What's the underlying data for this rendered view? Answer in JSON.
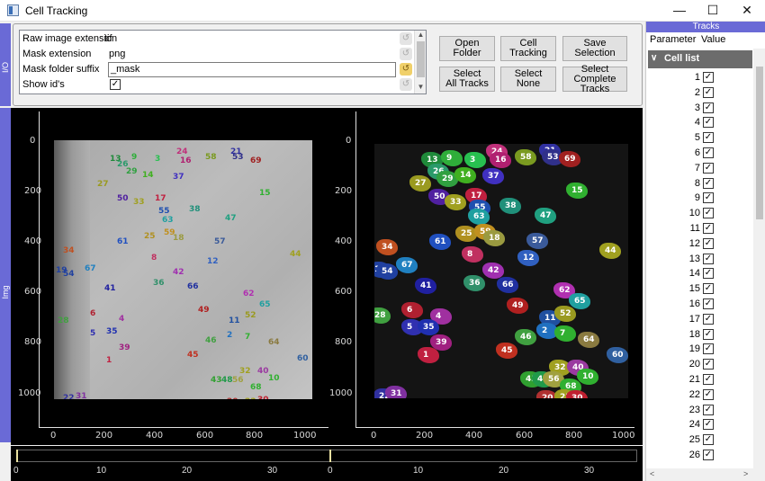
{
  "window": {
    "title": "Cell Tracking",
    "minimize": "—",
    "maximize": "☐",
    "close": "✕"
  },
  "io_panel": {
    "side_label": "I/O",
    "params": [
      {
        "label": "Raw image extension",
        "value": "tif"
      },
      {
        "label": "Mask extension",
        "value": "png"
      },
      {
        "label": "Mask folder suffix",
        "value": "_mask"
      },
      {
        "label": "Show id's",
        "checked": "✓"
      }
    ],
    "buttons": {
      "open_folder": "Open\nFolder",
      "cell_tracking": "Cell\nTracking",
      "save_selection": "Save\nSelection",
      "select_all_tracks": "Select\nAll Tracks",
      "select_none": "Select\nNone",
      "select_complete_tracks": "Select\nComplete Tracks"
    }
  },
  "img_panel": {
    "side_label": "Img",
    "y_ticks": [
      "0",
      "200",
      "400",
      "600",
      "800",
      "1000"
    ],
    "x_ticks": [
      "0",
      "200",
      "400",
      "600",
      "800",
      "1000"
    ]
  },
  "timeline": {
    "ticks": [
      "0",
      "10",
      "20",
      "30",
      "0",
      "10",
      "20",
      "30"
    ]
  },
  "tracks_panel": {
    "header": "Tracks",
    "col_parameter": "Parameter",
    "col_value": "Value",
    "group_label": "Cell list",
    "rows": [
      "1",
      "2",
      "3",
      "4",
      "5",
      "6",
      "7",
      "8",
      "9",
      "10",
      "11",
      "12",
      "13",
      "14",
      "15",
      "16",
      "17",
      "18",
      "19",
      "20",
      "21",
      "22",
      "23",
      "24",
      "25",
      "26"
    ],
    "check": "✓"
  },
  "mask_labels": [
    {
      "t": "13",
      "c": "#1f8a3a"
    },
    {
      "t": "9",
      "c": "#2fae3a"
    },
    {
      "t": "3",
      "c": "#28c050"
    },
    {
      "t": "24",
      "c": "#c0307a"
    },
    {
      "t": "16",
      "c": "#b02070"
    },
    {
      "t": "58",
      "c": "#7a9a20"
    },
    {
      "t": "21",
      "c": "#3030a0"
    },
    {
      "t": "53",
      "c": "#30308a"
    },
    {
      "t": "69",
      "c": "#a02020"
    },
    {
      "t": "26",
      "c": "#2a9a6a"
    },
    {
      "t": "29",
      "c": "#30a040"
    },
    {
      "t": "14",
      "c": "#40b020"
    },
    {
      "t": "37",
      "c": "#4030c0"
    },
    {
      "t": "27",
      "c": "#9a9a20"
    },
    {
      "t": "50",
      "c": "#5020a0"
    },
    {
      "t": "33",
      "c": "#a0a020"
    },
    {
      "t": "17",
      "c": "#c02040"
    },
    {
      "t": "55",
      "c": "#2050b0"
    },
    {
      "t": "38",
      "c": "#20907a"
    },
    {
      "t": "15",
      "c": "#30b030"
    },
    {
      "t": "63",
      "c": "#20a0a0"
    },
    {
      "t": "47",
      "c": "#20a080"
    },
    {
      "t": "61",
      "c": "#2050c0"
    },
    {
      "t": "25",
      "c": "#b09020"
    },
    {
      "t": "59",
      "c": "#c09020"
    },
    {
      "t": "18",
      "c": "#9a9a40"
    },
    {
      "t": "57",
      "c": "#3a5a9a"
    },
    {
      "t": "34",
      "c": "#c05020"
    },
    {
      "t": "44",
      "c": "#a0a020"
    },
    {
      "t": "8",
      "c": "#c03060"
    },
    {
      "t": "12",
      "c": "#3060c0"
    },
    {
      "t": "19",
      "c": "#2040a0"
    },
    {
      "t": "54",
      "c": "#2040a0"
    },
    {
      "t": "67",
      "c": "#2080c0"
    },
    {
      "t": "42",
      "c": "#a030b0"
    },
    {
      "t": "36",
      "c": "#30906a"
    },
    {
      "t": "41",
      "c": "#2020a0"
    },
    {
      "t": "66",
      "c": "#2030a0"
    },
    {
      "t": "62",
      "c": "#b030b0"
    },
    {
      "t": "49",
      "c": "#b02020"
    },
    {
      "t": "65",
      "c": "#20a0a0"
    },
    {
      "t": "6",
      "c": "#b02030"
    },
    {
      "t": "4",
      "c": "#a030a0"
    },
    {
      "t": "28",
      "c": "#40a040"
    },
    {
      "t": "5",
      "c": "#3030b0"
    },
    {
      "t": "35",
      "c": "#2030b0"
    },
    {
      "t": "11",
      "c": "#2050a0"
    },
    {
      "t": "52",
      "c": "#9a9a20"
    },
    {
      "t": "2",
      "c": "#2070c0"
    },
    {
      "t": "7",
      "c": "#30b030"
    },
    {
      "t": "46",
      "c": "#40a040"
    },
    {
      "t": "64",
      "c": "#8a7a40"
    },
    {
      "t": "39",
      "c": "#a02080"
    },
    {
      "t": "1",
      "c": "#c02040"
    },
    {
      "t": "45",
      "c": "#c03020"
    },
    {
      "t": "60",
      "c": "#3060a0"
    },
    {
      "t": "32",
      "c": "#a0a020"
    },
    {
      "t": "40",
      "c": "#9a3aa0"
    },
    {
      "t": "43",
      "c": "#30a030"
    },
    {
      "t": "48",
      "c": "#209a4a"
    },
    {
      "t": "56",
      "c": "#a0a040"
    },
    {
      "t": "10",
      "c": "#30b030"
    },
    {
      "t": "68",
      "c": "#30b030"
    },
    {
      "t": "20",
      "c": "#b03030"
    },
    {
      "t": "23",
      "c": "#a0a020"
    },
    {
      "t": "30",
      "c": "#c02030"
    },
    {
      "t": "22",
      "c": "#3030a0"
    },
    {
      "t": "31",
      "c": "#8030a0"
    }
  ]
}
